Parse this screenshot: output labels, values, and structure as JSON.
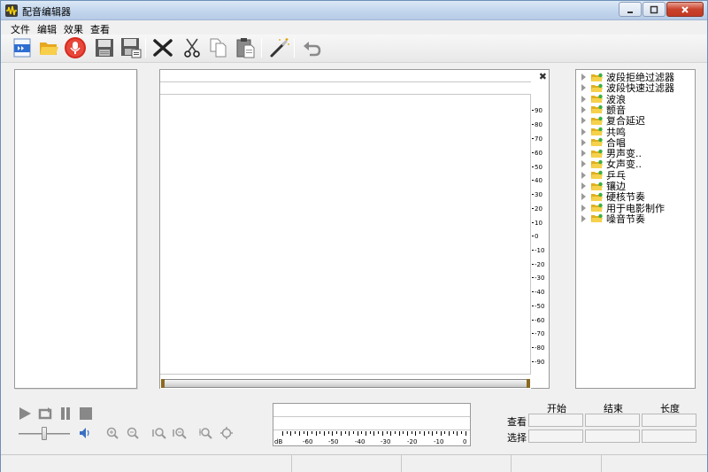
{
  "window": {
    "title": "配音编辑器",
    "controls": [
      "minimize",
      "maximize",
      "close"
    ]
  },
  "menu": [
    "文件",
    "编辑",
    "效果",
    "查看"
  ],
  "toolbar": {
    "buttons": [
      "new-icon",
      "open-folder-icon",
      "record-icon",
      "save-icon",
      "save-as-icon",
      "delete-icon",
      "cut-icon",
      "copy-icon",
      "paste-icon",
      "magic-wand-icon",
      "undo-icon"
    ]
  },
  "editor": {
    "close_symbol": "✖",
    "db_scale": [
      "90",
      "80",
      "70",
      "60",
      "50",
      "40",
      "30",
      "20",
      "10",
      "0",
      "-10",
      "-20",
      "-30",
      "-40",
      "-50",
      "-60",
      "-70",
      "-80",
      "-90"
    ]
  },
  "effects_tree": [
    "波段拒绝过滤器",
    "波段快速过滤器",
    "波浪",
    "颤音",
    "复合延迟",
    "共鸣",
    "合唱",
    "男声变..",
    "女声变..",
    "乒乓",
    "镶边",
    "硬核节奏",
    "用于电影制作",
    "噪音节奏"
  ],
  "meter": {
    "scale": [
      "dB",
      "-60",
      "-50",
      "-40",
      "-30",
      "-20",
      "-10",
      "0"
    ]
  },
  "selection": {
    "headers": [
      "开始",
      "结束",
      "长度"
    ],
    "rows": [
      "查看",
      "选择"
    ]
  },
  "colors": {
    "accent": "#3a6fc4",
    "record_red": "#d42a1e",
    "folder_yellow": "#f2c230"
  }
}
